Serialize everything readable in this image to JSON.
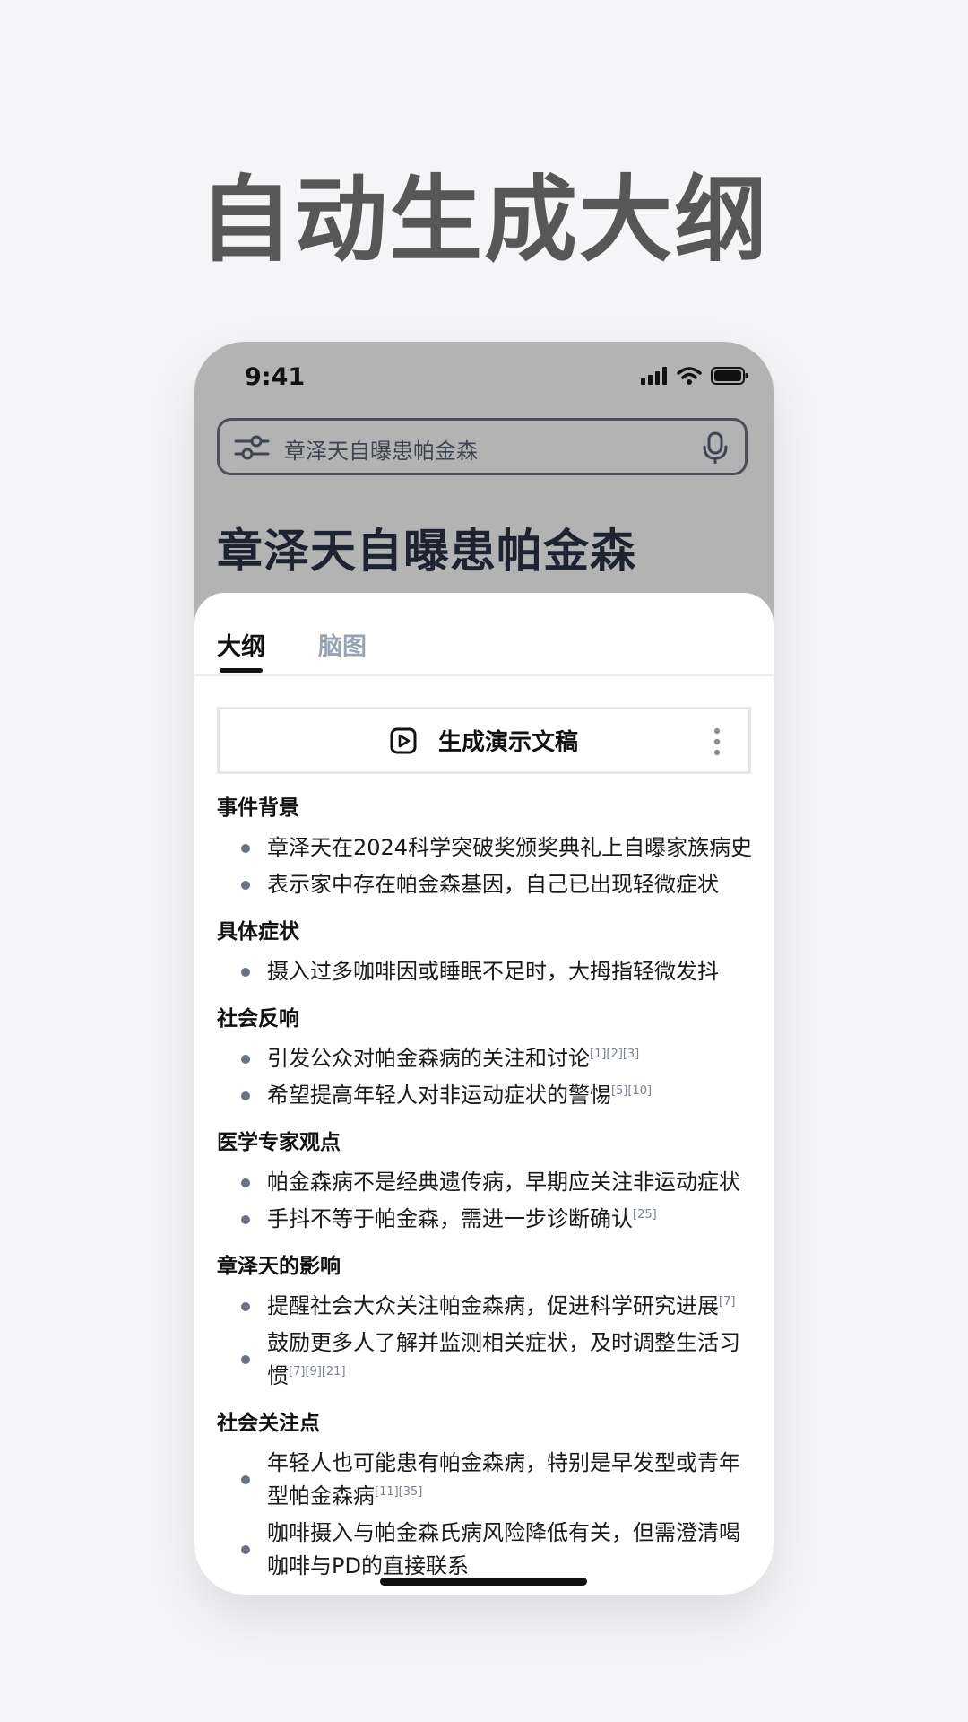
{
  "hero": {
    "title": "自动生成大纲"
  },
  "status_bar": {
    "time": "9:41"
  },
  "search": {
    "query": "章泽天自曝患帕金森"
  },
  "document": {
    "title": "章泽天自曝患帕金森"
  },
  "tabs": [
    {
      "label": "大纲",
      "active": true
    },
    {
      "label": "脑图",
      "active": false
    }
  ],
  "present_button": {
    "label": "生成演示文稿"
  },
  "outline": [
    {
      "heading": "事件背景",
      "items": [
        {
          "text": "章泽天在2024科学突破奖颁奖典礼上自曝家族病史",
          "cite": ""
        },
        {
          "text": "表示家中存在帕金森基因，自己已出现轻微症状",
          "cite": ""
        }
      ]
    },
    {
      "heading": "具体症状",
      "items": [
        {
          "text": "摄入过多咖啡因或睡眠不足时，大拇指轻微发抖",
          "cite": ""
        }
      ]
    },
    {
      "heading": "社会反响",
      "items": [
        {
          "text": "引发公众对帕金森病的关注和讨论",
          "cite": "[1][2][3]"
        },
        {
          "text": "希望提高年轻人对非运动症状的警惕",
          "cite": "[5][10]"
        }
      ]
    },
    {
      "heading": "医学专家观点",
      "items": [
        {
          "text": "帕金森病不是经典遗传病，早期应关注非运动症状",
          "cite": ""
        },
        {
          "text": "手抖不等于帕金森，需进一步诊断确认",
          "cite": "[25]"
        }
      ]
    },
    {
      "heading": "章泽天的影响",
      "items": [
        {
          "text": "提醒社会大众关注帕金森病，促进科学研究进展",
          "cite": "[7]"
        },
        {
          "text": "鼓励更多人了解并监测相关症状，及时调整生活习惯",
          "cite": "[7][9][21]"
        }
      ]
    },
    {
      "heading": "社会关注点",
      "items": [
        {
          "text": "年轻人也可能患有帕金森病，特别是早发型或青年型帕金森病",
          "cite": "[11][35]"
        },
        {
          "text": "咖啡摄入与帕金森氏病风险降低有关，但需澄清喝咖啡与PD的直接联系",
          "cite": ""
        }
      ]
    }
  ],
  "icons": {
    "filter": "sliders-icon",
    "mic": "microphone-icon",
    "present": "play-square-icon",
    "more": "more-vertical-icon",
    "signal": "cellular-signal-icon",
    "wifi": "wifi-icon",
    "battery": "battery-icon"
  }
}
